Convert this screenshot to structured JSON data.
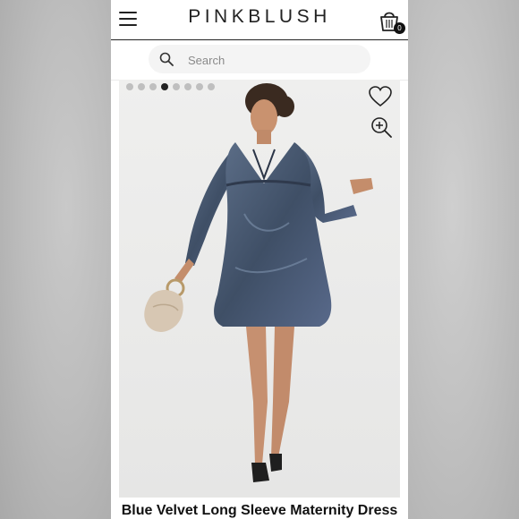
{
  "header": {
    "brand": "PINKBLUSH",
    "cart_count": "0",
    "menu_icon": "menu-icon",
    "cart_icon": "shopping-bag-icon"
  },
  "search": {
    "placeholder": "Search",
    "icon": "search-icon"
  },
  "gallery": {
    "dot_count": 8,
    "active_index": 3,
    "wishlist_icon": "heart-icon",
    "zoom_icon": "zoom-in-icon"
  },
  "product": {
    "title": "Blue Velvet Long Sleeve Maternity Dress"
  },
  "colors": {
    "brand_text": "#222222",
    "dress": "#4a5b72",
    "photo_bg": "#ececeb"
  }
}
